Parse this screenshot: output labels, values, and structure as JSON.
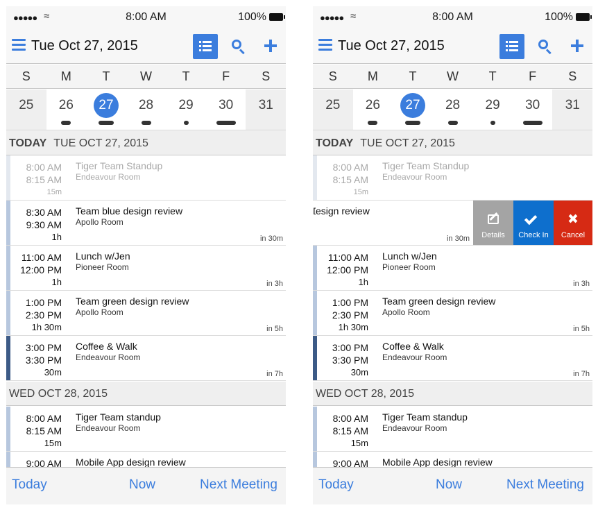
{
  "status_bar": {
    "signal": "●●●●●",
    "time": "8:00 AM",
    "battery": "100%"
  },
  "header": {
    "title": "Tue Oct 27, 2015"
  },
  "week": {
    "days": [
      "S",
      "M",
      "T",
      "W",
      "T",
      "F",
      "S"
    ],
    "dates": [
      "25",
      "26",
      "27",
      "28",
      "29",
      "30",
      "31"
    ]
  },
  "sections": {
    "today": {
      "label": "TODAY",
      "date": "TUE OCT 27, 2015"
    },
    "tomorrow": {
      "date": "WED OCT 28, 2015"
    }
  },
  "events_today": [
    {
      "start": "8:00 AM",
      "end": "8:15 AM",
      "duration": "15m",
      "title": "Tiger Team Standup",
      "room": "Endeavour Room",
      "relative": ""
    },
    {
      "start": "8:30 AM",
      "end": "9:30 AM",
      "duration": "1h",
      "title": "Team blue design review",
      "room": "Apollo Room",
      "relative": "in 30m"
    },
    {
      "start": "11:00 AM",
      "end": "12:00 PM",
      "duration": "1h",
      "title": "Lunch w/Jen",
      "room": "Pioneer Room",
      "relative": "in 3h"
    },
    {
      "start": "1:00 PM",
      "end": "2:30 PM",
      "duration": "1h 30m",
      "title": "Team green design review",
      "room": "Apollo Room",
      "relative": "in 5h"
    },
    {
      "start": "3:00 PM",
      "end": "3:30 PM",
      "duration": "30m",
      "title": "Coffee & Walk",
      "room": "Endeavour Room",
      "relative": "in 7h"
    }
  ],
  "events_tomorrow": [
    {
      "start": "8:00 AM",
      "end": "8:15 AM",
      "duration": "15m",
      "title": "Tiger Team standup",
      "room": "Endeavour Room"
    },
    {
      "start": "9:00 AM",
      "title": "Mobile App design review"
    }
  ],
  "swipe": {
    "partial_title": "esign review",
    "relative": "in 30m",
    "actions": {
      "details": "Details",
      "check_in": "Check In",
      "cancel": "Cancel"
    }
  },
  "toolbar": {
    "today": "Today",
    "now": "Now",
    "next_meeting": "Next Meeting"
  },
  "colors": {
    "accent": "#3b7ddd",
    "check_in": "#0e6fcd",
    "cancel": "#d62a14",
    "details": "#a4a4a4"
  }
}
